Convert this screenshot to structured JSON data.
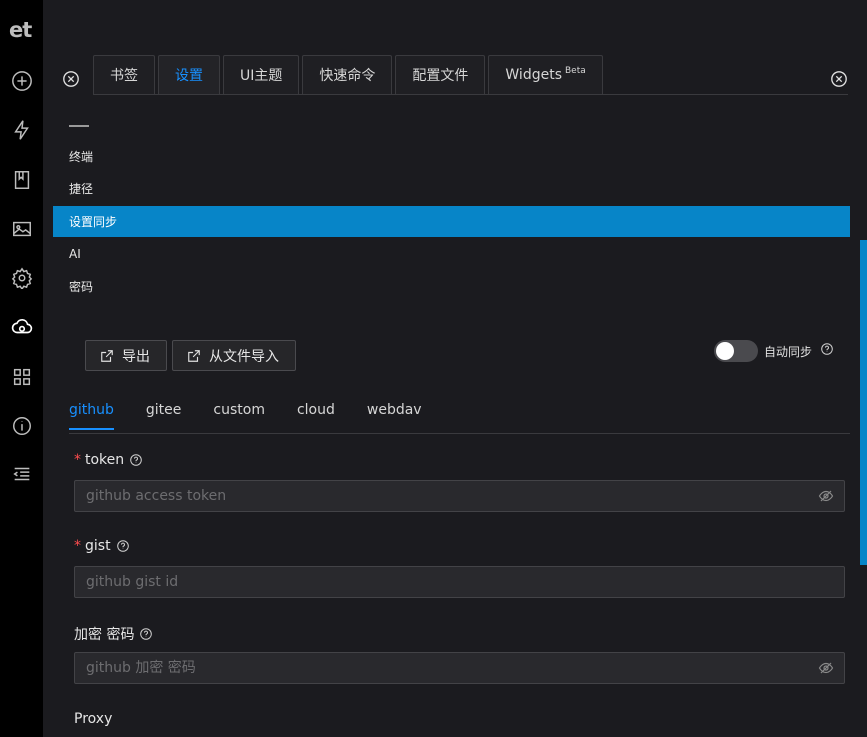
{
  "rail": {
    "logo": "et",
    "icons": [
      "plus-circle-icon",
      "thunderbolt-icon",
      "book-icon",
      "picture-icon",
      "settings-icon",
      "cloud-sync-icon",
      "apps-icon",
      "info-icon",
      "menu-fold-icon"
    ]
  },
  "tabs": [
    {
      "label": "书签"
    },
    {
      "label": "设置"
    },
    {
      "label": "UI主题"
    },
    {
      "label": "快速命令"
    },
    {
      "label": "配置文件"
    },
    {
      "label": "Widgets",
      "badge": "Beta"
    }
  ],
  "menu": {
    "items": [
      "终端",
      "捷径",
      "设置同步",
      "AI",
      "密码"
    ],
    "active": "设置同步"
  },
  "actions": {
    "export_label": "导出",
    "import_label": "从文件导入"
  },
  "autosync": {
    "label": "自动同步",
    "enabled": false
  },
  "subtabs": [
    "github",
    "gitee",
    "custom",
    "cloud",
    "webdav"
  ],
  "form": {
    "token_label": "token",
    "token_placeholder": "github access token",
    "gist_label": "gist",
    "gist_placeholder": "github gist id",
    "password_label": "加密 密码",
    "password_placeholder": "github 加密 密码",
    "proxy_label": "Proxy"
  },
  "colors": {
    "accent": "#1890ff",
    "selected_bg": "#0785c8",
    "required": "#ff4d4f"
  }
}
